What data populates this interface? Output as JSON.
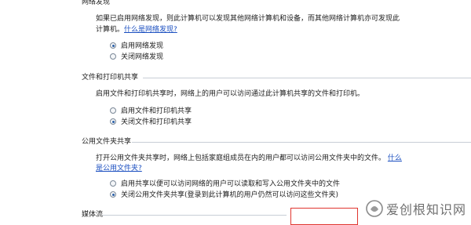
{
  "network_discovery": {
    "header": "网络发现",
    "description_line1": "如果已启用网络发现，则此计算机可以发现其他网络计算机和设备，而其他网络计算机亦可发现此",
    "description_line2": "计算机。",
    "link": "什么是网络发现?",
    "options": [
      {
        "label": "启用网络发现",
        "checked": true
      },
      {
        "label": "关闭网络发现",
        "checked": false
      }
    ]
  },
  "file_printer_sharing": {
    "header": "文件和打印机共享",
    "description": "启用文件和打印机共享时，网络上的用户可以访问通过此计算机共享的文件和打印机。",
    "options": [
      {
        "label": "启用文件和打印机共享",
        "checked": false
      },
      {
        "label": "关闭文件和打印机共享",
        "checked": true
      }
    ]
  },
  "public_folder_sharing": {
    "header": "公用文件夹共享",
    "description_line1": "打开公用文件夹共享时，网络上包括家庭组成员在内的用户都可以访问公用文件夹中的文件。",
    "link_part1": "什么",
    "link_part2": "是公用文件夹?",
    "options": [
      {
        "label": "启用共享以便可以访问网络的用户可以读取和写入公用文件夹中的文件",
        "checked": false
      },
      {
        "label": "关闭公用文件夹共享(登录到此计算机的用户仍然可以访问这些文件夹)",
        "checked": true
      }
    ]
  },
  "media_streaming": {
    "header": "媒体流"
  },
  "watermark": {
    "text": "爱创根知识网"
  },
  "colors": {
    "link": "#1b4fc0",
    "highlight_box": "#e0352f",
    "divider": "#c8ced6"
  }
}
